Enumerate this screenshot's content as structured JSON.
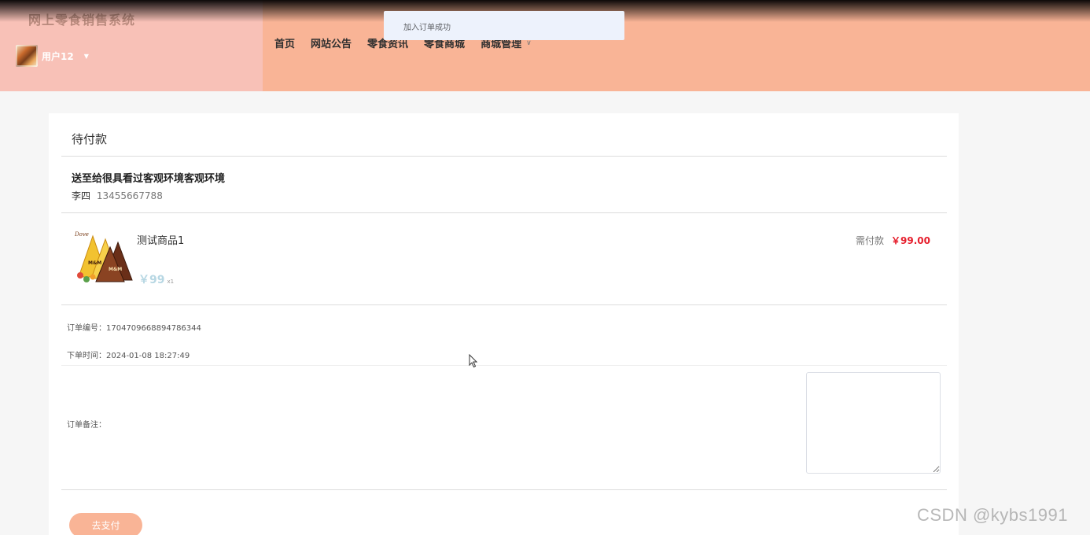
{
  "header": {
    "site_title": "网上零食销售系统",
    "user": {
      "name": "用户12",
      "avatar_icon": "snack-avatar-icon"
    },
    "nav": [
      {
        "label": "首页"
      },
      {
        "label": "网站公告"
      },
      {
        "label": "零食资讯"
      },
      {
        "label": "零食商城"
      },
      {
        "label": "商城管理",
        "has_dropdown": true
      }
    ]
  },
  "toast": {
    "message": "加入订单成功"
  },
  "order": {
    "status_title": "待付款",
    "address": {
      "title": "送至给很具看过客观环境客观环境",
      "name": "李四",
      "phone": "13455667788"
    },
    "product": {
      "name": "测试商品1",
      "price": "￥99",
      "qty": "x1",
      "image_icon": "snack-product-image"
    },
    "need_pay": {
      "label": "需付款",
      "value": "￥99.00"
    },
    "order_no": "订单编号：1704709668894786344",
    "order_time": "下单时间：2024-01-08 18:27:49",
    "remark_label": "订单备注：",
    "remark_value": "",
    "pay_button": "去支付"
  },
  "watermark": "CSDN @kybs1991",
  "colors": {
    "header_bg": "#f9b496",
    "header_left_bg": "#f8c1b7",
    "accent_price": "#e61e2c",
    "button_bg": "#f9b496"
  }
}
